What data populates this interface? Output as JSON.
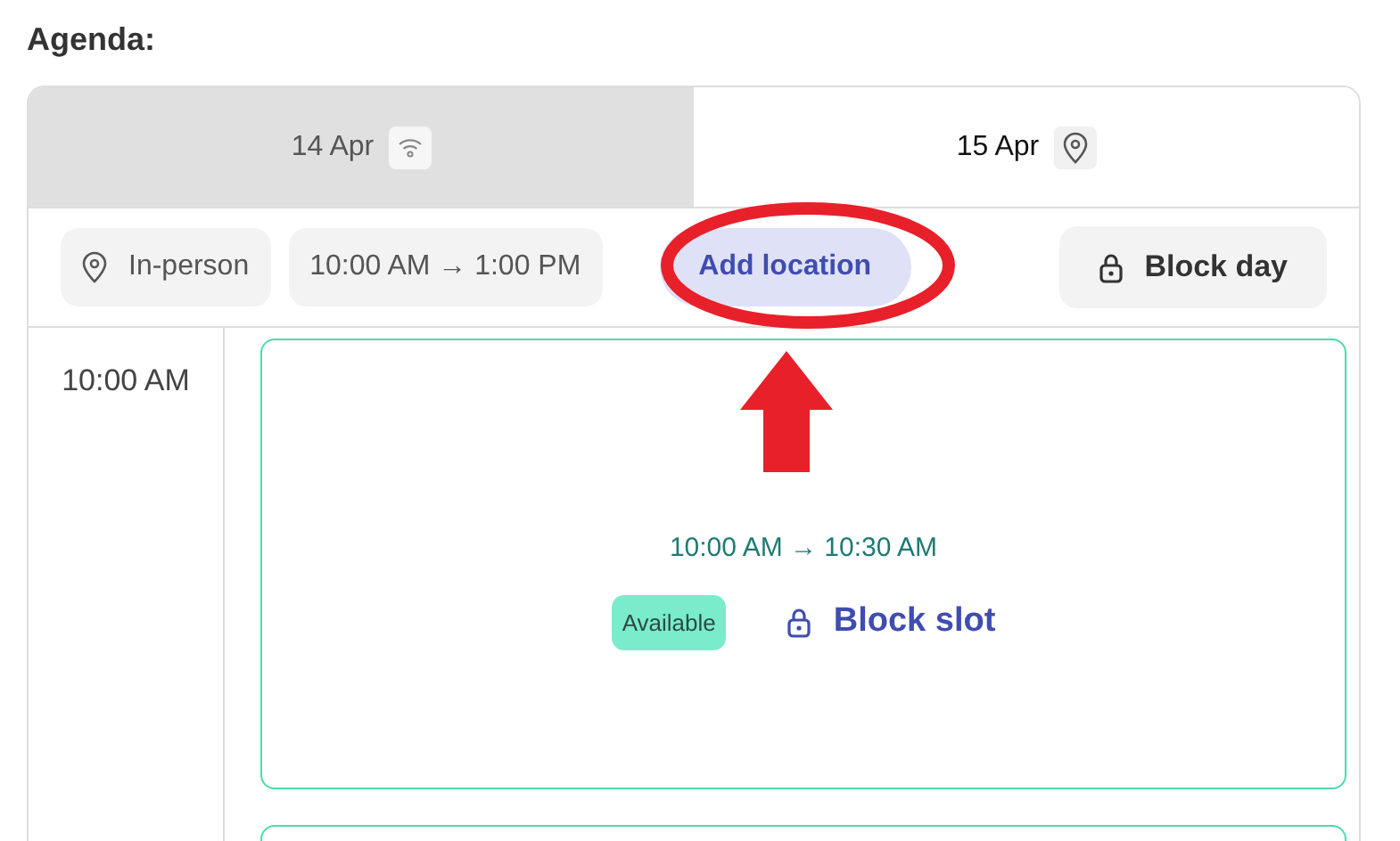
{
  "heading": "Agenda:",
  "tabs": [
    {
      "label": "14 Apr",
      "kind": "online",
      "selected": false
    },
    {
      "label": "15 Apr",
      "kind": "in-person",
      "selected": true
    }
  ],
  "toolbar": {
    "location": "In-person",
    "hours": "10:00 AM → 1:00 PM",
    "add_location": "Add location",
    "block_day": "Block day"
  },
  "slots": [
    {
      "time": "10:00 AM",
      "range": "10:00 AM → 10:30 AM",
      "status": "Available",
      "action": "Block slot"
    }
  ],
  "annotation": {
    "kind": "circle-and-arrow"
  }
}
